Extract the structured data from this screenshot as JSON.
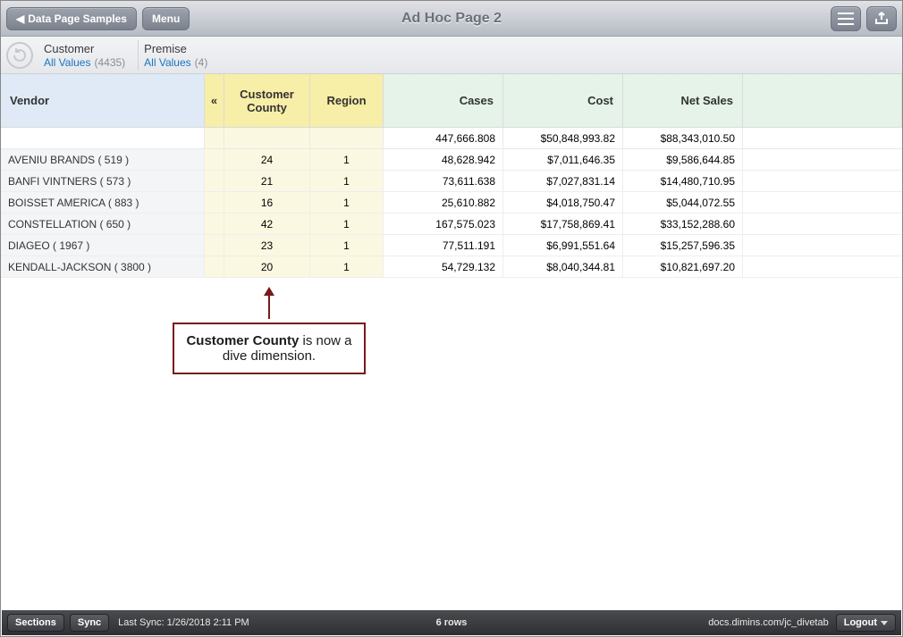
{
  "header": {
    "breadcrumb_label": "Data Page Samples",
    "menu_label": "Menu",
    "title": "Ad Hoc Page 2"
  },
  "filters": {
    "customer": {
      "label": "Customer",
      "text": "All Values",
      "count": "(4435)"
    },
    "premise": {
      "label": "Premise",
      "text": "All Values",
      "count": "(4)"
    }
  },
  "columns": {
    "vendor": "Vendor",
    "cc": "Customer County",
    "region": "Region",
    "cases": "Cases",
    "cost": "Cost",
    "net": "Net Sales",
    "collapse_glyph": "«"
  },
  "totals": {
    "cases": "447,666.808",
    "cost": "$50,848,993.82",
    "net": "$88,343,010.50"
  },
  "rows": [
    {
      "vendor": "AVENIU BRANDS  ( 519 )",
      "cc": "24",
      "region": "1",
      "cases": "48,628.942",
      "cost": "$7,011,646.35",
      "net": "$9,586,644.85"
    },
    {
      "vendor": "BANFI VINTNERS  ( 573 )",
      "cc": "21",
      "region": "1",
      "cases": "73,611.638",
      "cost": "$7,027,831.14",
      "net": "$14,480,710.95"
    },
    {
      "vendor": "BOISSET AMERICA  ( 883 )",
      "cc": "16",
      "region": "1",
      "cases": "25,610.882",
      "cost": "$4,018,750.47",
      "net": "$5,044,072.55"
    },
    {
      "vendor": "CONSTELLATION  ( 650 )",
      "cc": "42",
      "region": "1",
      "cases": "167,575.023",
      "cost": "$17,758,869.41",
      "net": "$33,152,288.60"
    },
    {
      "vendor": "DIAGEO  ( 1967 )",
      "cc": "23",
      "region": "1",
      "cases": "77,511.191",
      "cost": "$6,991,551.64",
      "net": "$15,257,596.35"
    },
    {
      "vendor": "KENDALL-JACKSON  ( 3800 )",
      "cc": "20",
      "region": "1",
      "cases": "54,729.132",
      "cost": "$8,040,344.81",
      "net": "$10,821,697.20"
    }
  ],
  "annotation": {
    "bold": "Customer County",
    "rest": " is now a dive dimension."
  },
  "footer": {
    "sections": "Sections",
    "sync": "Sync",
    "last_sync": "Last Sync: 1/26/2018 2:11 PM",
    "rowcount": "6 rows",
    "host": "docs.dimins.com/jc_divetab",
    "logout": "Logout"
  }
}
